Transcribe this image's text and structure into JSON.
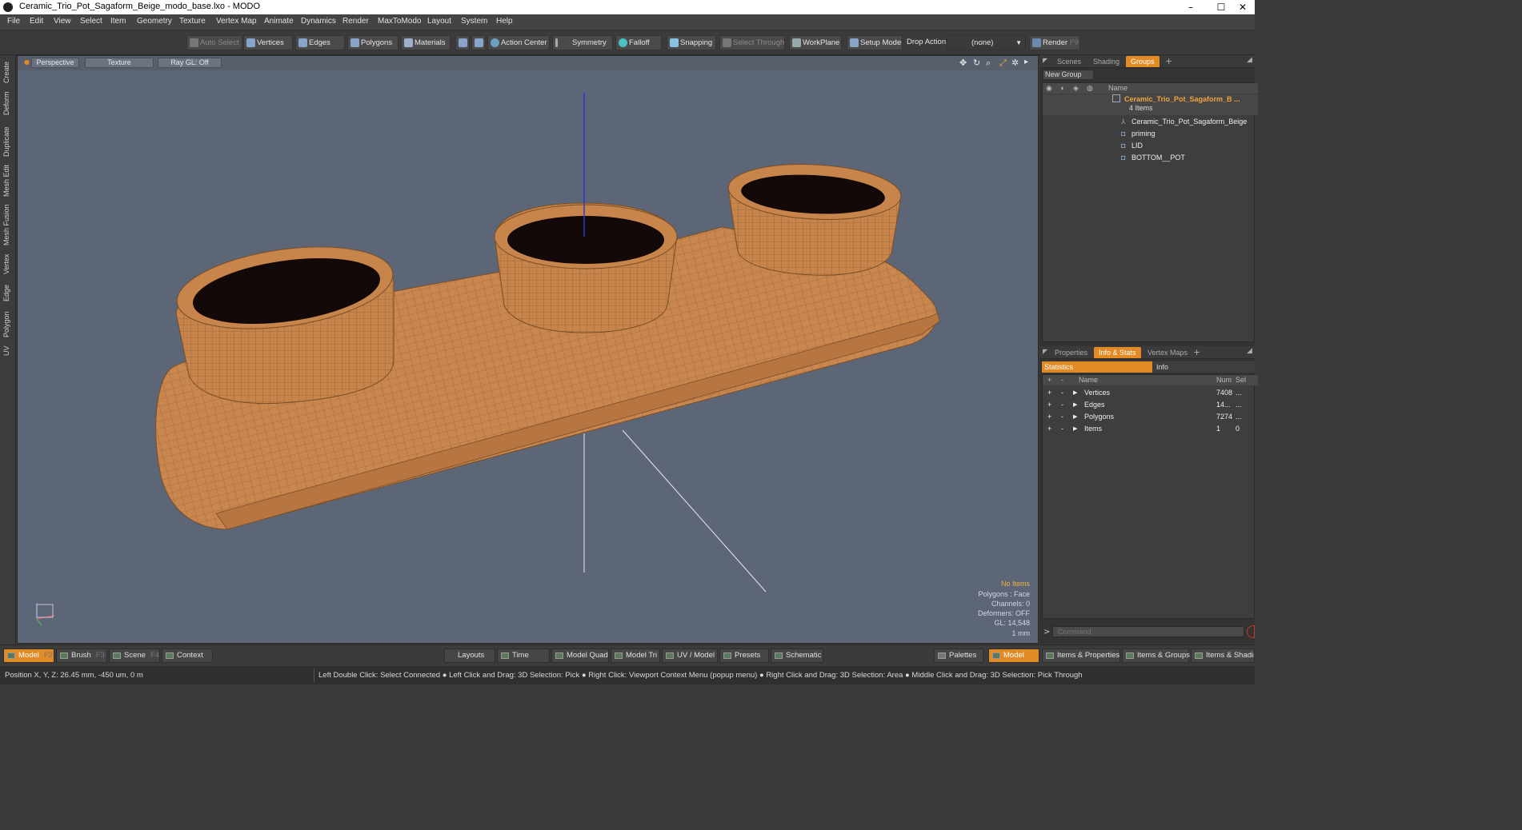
{
  "window": {
    "title": "Ceramic_Trio_Pot_Sagaform_Beige_modo_base.lxo - MODO",
    "min": "–",
    "max": "☐",
    "close": "✕"
  },
  "menu": [
    "File",
    "Edit",
    "View",
    "Select",
    "Item",
    "Geometry",
    "Texture",
    "Vertex Map",
    "Animate",
    "Dynamics",
    "Render",
    "MaxToModo",
    "Layout",
    "System",
    "Help"
  ],
  "toolbar": {
    "auto_select": "Auto Select",
    "vertices": "Vertices",
    "edges": "Edges",
    "polygons": "Polygons",
    "materials": "Materials",
    "action_center": "Action Center",
    "symmetry": "Symmetry",
    "falloff": "Falloff",
    "snapping": "Snapping",
    "select_through": "Select Through",
    "workplane": "WorkPlane",
    "setup_mode": "Setup Mode",
    "drop_action_label": "Drop Action",
    "drop_action_value": "(none)",
    "render": "Render",
    "render_key": "F9"
  },
  "left_tabs": [
    "Create",
    "Deform",
    "Duplicate",
    "Mesh Edit",
    "Mesh Fusion",
    "Vertex",
    "Edge",
    "Polygon",
    "UV"
  ],
  "viewport": {
    "view": "Perspective",
    "shading": "Texture",
    "raygl": "Ray GL: Off",
    "info": {
      "selection": "No Items",
      "polygons": "Polygons : Face",
      "channels": "Channels: 0",
      "deformers": "Deformers: OFF",
      "gl": "GL: 14,548",
      "scale": "1 mm"
    },
    "colors": {
      "background": "#5c6676",
      "body": "#c9874f",
      "wire": "#8a5a2e",
      "soil": "#120908"
    }
  },
  "groups_panel": {
    "tabs": [
      "Scenes",
      "Shading",
      "Groups"
    ],
    "active_tab": "Groups",
    "new_group": "New Group",
    "col_name": "Name",
    "root": {
      "name": "Ceramic_Trio_Pot_Sagaform_B ...",
      "count": "4 Items"
    },
    "items": [
      "Ceramic_Trio_Pot_Sagaform_Beige",
      "priming",
      "LID",
      "BOTTOM__POT"
    ]
  },
  "info_panel": {
    "tabs": [
      "Properties",
      "Info & Stats",
      "Vertex Maps"
    ],
    "active_tab": "Info & Stats",
    "subtabs": [
      "Statistics",
      "Info"
    ],
    "cols": {
      "name": "Name",
      "num": "Num",
      "sel": "Sel"
    },
    "rows": [
      {
        "name": "Vertices",
        "num": "7408",
        "sel": "..."
      },
      {
        "name": "Edges",
        "num": "14...",
        "sel": "..."
      },
      {
        "name": "Polygons",
        "num": "7274",
        "sel": "..."
      },
      {
        "name": "Items",
        "num": "1",
        "sel": "0"
      }
    ],
    "command_placeholder": "Command"
  },
  "bottom_bar": {
    "model": "Model",
    "model_key": "F2",
    "brush": "Brush",
    "brush_key": "F3",
    "scene": "Scene",
    "scene_key": "F4",
    "context": "Context",
    "layouts": "Layouts",
    "time": "Time",
    "model_quad": "Model Quad",
    "model_tri": "Model Tri",
    "uv_model": "UV / Model",
    "presets": "Presets",
    "schematic": "Schematic",
    "palettes": "Palettes",
    "model2": "Model",
    "items_properties": "Items & Properties",
    "items_groups": "Items & Groups",
    "items_shading": "Items & Shading"
  },
  "status": {
    "position": "Position X, Y, Z:   26.45 mm, -450 um, 0 m",
    "hints": "Left Double Click: Select Connected ● Left Click and Drag: 3D Selection: Pick ● Right Click: Viewport Context Menu (popup menu) ● Right Click and Drag: 3D Selection: Area ● Middle Click and Drag: 3D Selection: Pick Through"
  },
  "accent": "#e28a24"
}
